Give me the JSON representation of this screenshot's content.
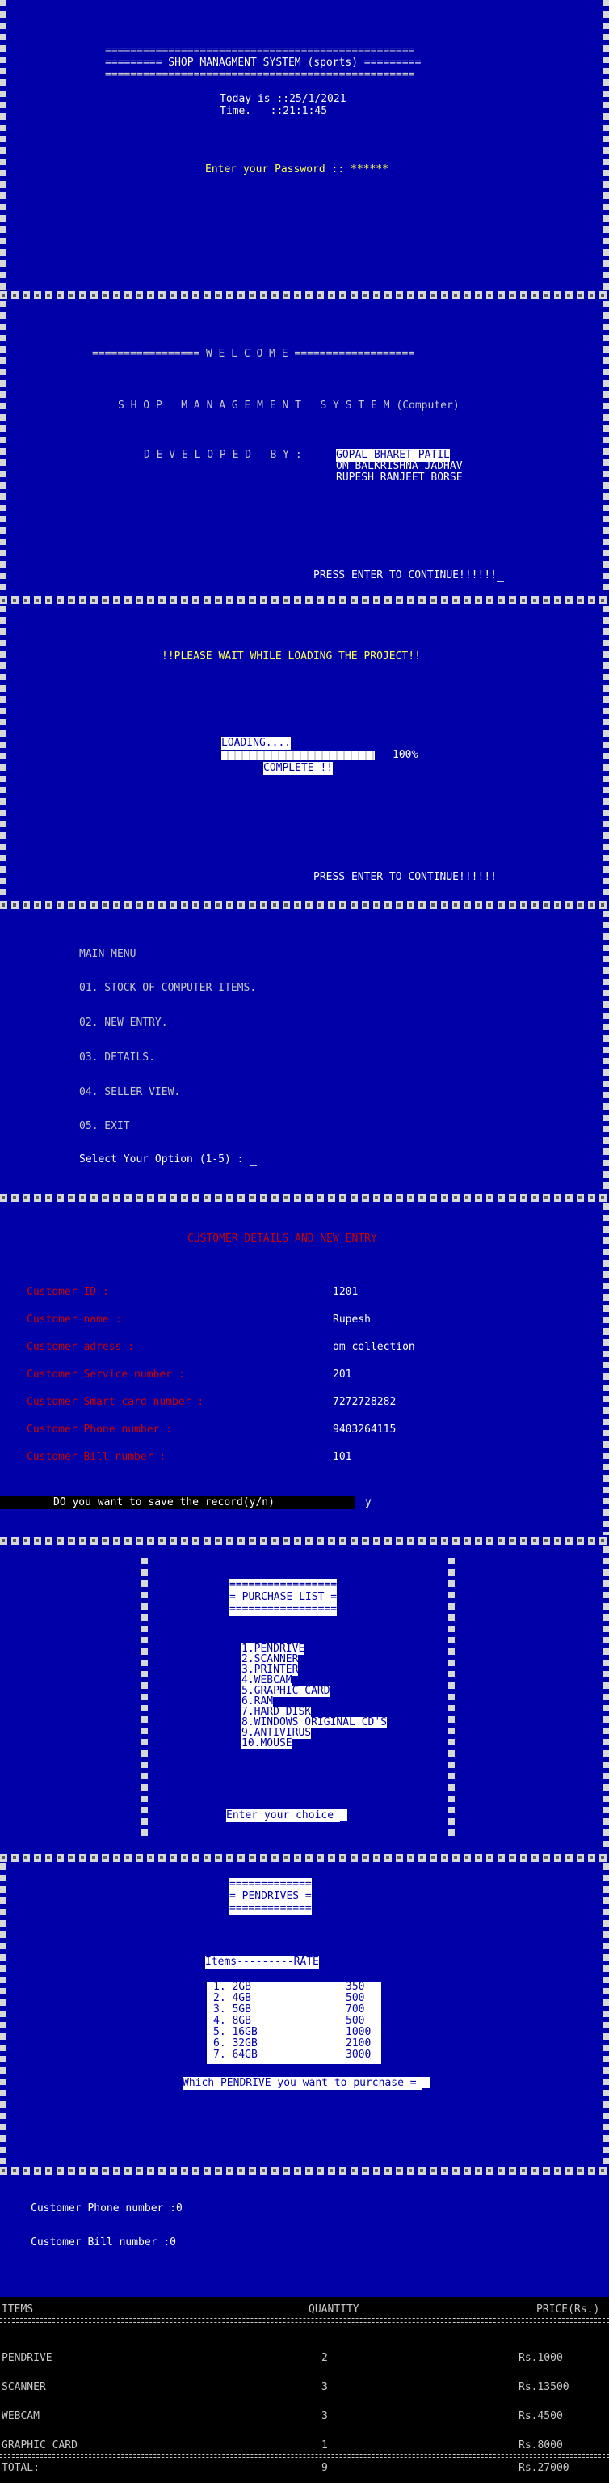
{
  "screen1": {
    "eq_line": "=================================================",
    "title": "========= SHOP MANAGMENT SYSTEM (sports) =========",
    "date_line": "Today is ::25/1/2021",
    "time_line": "Time.   ::21:1:45",
    "password_prompt": "Enter your Password :: ******"
  },
  "screen2": {
    "welcome": "================= W E L C O M E ===================",
    "title": "S H O P   M A N A G E M E N T   S Y S T E M (Computer)",
    "dev_label": "D E V E L O P E D   B Y :",
    "dev1": "GOPAL BHARET PATIL",
    "dev2": "OM BALKRISHNA JADHAV",
    "dev3": "RUPESH RANJEET BORSE",
    "continue": "PRESS ENTER TO CONTINUE!!!!!!"
  },
  "screen3": {
    "wait": "!!PLEASE WAIT WHILE LOADING THE PROJECT!!",
    "loading": "LOADING....",
    "percent": "100%",
    "complete": "COMPLETE !!",
    "progress": 1.0,
    "continue": "PRESS ENTER TO CONTINUE!!!!!!"
  },
  "screen4": {
    "title": "MAIN MENU",
    "items": [
      "01. STOCK OF COMPUTER ITEMS.",
      "02. NEW ENTRY.",
      "03. DETAILS.",
      "04. SELLER VIEW.",
      "05. EXIT"
    ],
    "prompt": "Select Your Option (1-5) : "
  },
  "screen5": {
    "title": "CUSTOMER DETAILS AND NEW ENTRY",
    "fields": [
      {
        "label": "Customer ID :",
        "value": "1201"
      },
      {
        "label": "Customer name :",
        "value": "Rupesh"
      },
      {
        "label": "Customer adress :",
        "value": "om collection"
      },
      {
        "label": "Customer Service number :",
        "value": "201"
      },
      {
        "label": "Customer Smart card number :",
        "value": "7272728282"
      },
      {
        "label": "Customer Phone number :",
        "value": "9403264115"
      },
      {
        "label": "Customer Bill number :",
        "value": "101"
      }
    ],
    "save_prompt": "DO you want to save the record(y/n)",
    "save_answer": "y"
  },
  "screen6": {
    "eq": "=================",
    "title": "= PURCHASE LIST =",
    "items": [
      "1.PENDRIVE",
      "2.SCANNER",
      "3.PRINTER",
      "4.WEBCAM",
      "5.GRAPHIC CARD",
      "6.RAM",
      "7.HARD DISK",
      "8.WINDOWS ORIGINAL CD'S",
      "9.ANTIVIRUS",
      "10.MOUSE"
    ],
    "prompt": "Enter your choice "
  },
  "screen7": {
    "eq": "=============",
    "title": "= PENDRIVES =",
    "header": "Items---------RATE",
    "rows": [
      {
        "item": "1. 2GB",
        "rate": "350"
      },
      {
        "item": "2. 4GB",
        "rate": "500"
      },
      {
        "item": "3. 5GB",
        "rate": "700"
      },
      {
        "item": "4. 8GB",
        "rate": "500"
      },
      {
        "item": "5. 16GB",
        "rate": "1000"
      },
      {
        "item": "6. 32GB",
        "rate": "2100"
      },
      {
        "item": "7. 64GB",
        "rate": "3000"
      }
    ],
    "prompt": "Which PENDRIVE you want to purchase = "
  },
  "screen8": {
    "phone": "Customer Phone number :0",
    "bill": "Customer Bill number :0",
    "headers": [
      "ITEMS",
      "QUANTITY",
      "PRICE(Rs.)"
    ],
    "rows": [
      {
        "item": "PENDRIVE",
        "qty": "2",
        "price": "Rs.1000"
      },
      {
        "item": "SCANNER",
        "qty": "3",
        "price": "Rs.13500"
      },
      {
        "item": "WEBCAM",
        "qty": "3",
        "price": "Rs.4500"
      },
      {
        "item": "GRAPHIC CARD",
        "qty": "1",
        "price": "Rs.8000"
      }
    ],
    "total_label": "TOTAL:",
    "total_qty": "9",
    "total_price": "Rs.27000"
  }
}
